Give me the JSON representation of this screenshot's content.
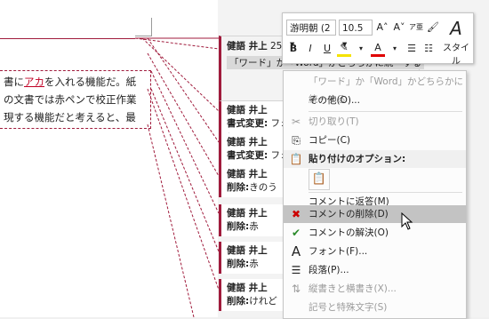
{
  "document": {
    "lines": [
      {
        "before": "書に",
        "ins": "アカ",
        "after": "を入れる機能だ。紙"
      },
      {
        "before": "の文書では赤ペンで校正作業",
        "ins": "",
        "after": ""
      },
      {
        "before": "現する機能だと考えると、最",
        "ins": "",
        "after": ""
      }
    ]
  },
  "top_comment": {
    "author": "健語 井上",
    "time": "25 分",
    "text": "「ワード」か「Word」かどちらかに統一する"
  },
  "comments": [
    {
      "author": "健語 井上",
      "action": "書式変更:",
      "value": "フォン"
    },
    {
      "author": "健語 井上",
      "action": "書式変更:",
      "value": "フォン"
    },
    {
      "author": "健語 井上",
      "action": "削除:",
      "value": "きのう"
    },
    {
      "author": "健語 井上",
      "action": "削除:",
      "value": "赤"
    },
    {
      "author": "健語 井上",
      "action": "削除:",
      "value": "赤"
    },
    {
      "author": "健語 井上",
      "action": "削除:",
      "value": "けれど"
    }
  ],
  "mini_toolbar": {
    "font": "游明朝 (2 ▾",
    "size": "10.5 ▾",
    "grow": "A˄",
    "shrink": "A˅",
    "phonetic": "ア亜",
    "bold": "B",
    "italic": "I",
    "underline": "U",
    "highlight": "✎",
    "font_color": "A",
    "bullets": "☰",
    "numbering": "☷",
    "style_label": "スタイル"
  },
  "context_menu": {
    "items": [
      {
        "icon": "",
        "label": "「ワード」か「Word」かどちらかに統一する",
        "disabled": true
      },
      {
        "icon": "",
        "label": "その他(O)...",
        "disabled": false
      },
      {
        "icon": "✂",
        "label": "切り取り(T)",
        "disabled": true
      },
      {
        "icon": "⎘",
        "label": "コピー(C)",
        "disabled": false
      },
      {
        "icon": "📋",
        "label": "貼り付けのオプション:",
        "disabled": false
      },
      {
        "icon": "",
        "label": "コメントに返答(M)",
        "disabled": false
      },
      {
        "icon": "✖",
        "label": "コメントの削除(D)",
        "disabled": false
      },
      {
        "icon": "✔",
        "label": "コメントの解決(O)",
        "disabled": false
      },
      {
        "icon": "A",
        "label": "フォント(F)...",
        "disabled": false
      },
      {
        "icon": "☰",
        "label": "段落(P)...",
        "disabled": false
      },
      {
        "icon": "⇅",
        "label": "縦書きと横書き(X)...",
        "disabled": true
      },
      {
        "icon": "",
        "label": "記号と特殊文字(S)",
        "disabled": true
      }
    ]
  },
  "colors": {
    "markup": "#a01b3c",
    "insertion": "#c00024",
    "highlight": "#c3c3c3"
  }
}
